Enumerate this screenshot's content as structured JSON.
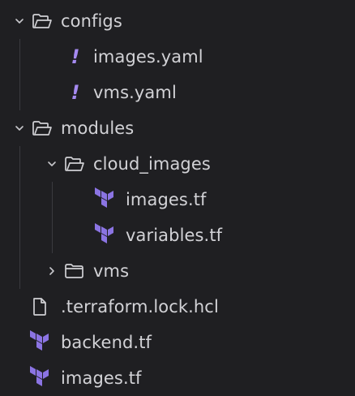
{
  "colors": {
    "background": "#1f1f22",
    "text": "#d2d2d6",
    "icon_outline": "#d0d0d4",
    "terraform": "#8b74e3",
    "yaml": "#a58af0"
  },
  "tree": [
    {
      "label": "configs",
      "type": "folder",
      "expanded": true,
      "icon": "folder-open-icon"
    },
    {
      "label": "images.yaml",
      "type": "file",
      "icon": "yaml-exclamation-icon"
    },
    {
      "label": "vms.yaml",
      "type": "file",
      "icon": "yaml-exclamation-icon"
    },
    {
      "label": "modules",
      "type": "folder",
      "expanded": true,
      "icon": "folder-open-icon"
    },
    {
      "label": "cloud_images",
      "type": "folder",
      "expanded": true,
      "icon": "folder-open-icon"
    },
    {
      "label": "images.tf",
      "type": "file",
      "icon": "terraform-icon"
    },
    {
      "label": "variables.tf",
      "type": "file",
      "icon": "terraform-icon"
    },
    {
      "label": "vms",
      "type": "folder",
      "expanded": false,
      "icon": "folder-closed-icon"
    },
    {
      "label": ".terraform.lock.hcl",
      "type": "file",
      "icon": "file-icon"
    },
    {
      "label": "backend.tf",
      "type": "file",
      "icon": "terraform-icon"
    },
    {
      "label": "images.tf",
      "type": "file",
      "icon": "terraform-icon"
    }
  ],
  "yaml_glyph": "!"
}
